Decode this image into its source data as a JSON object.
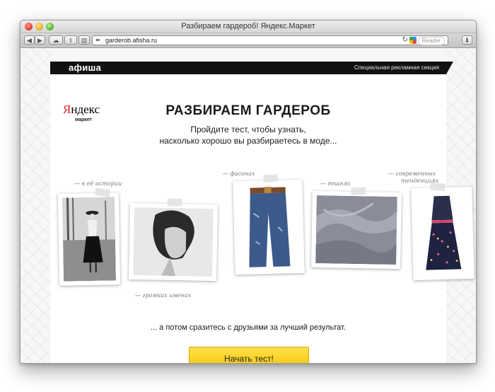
{
  "window": {
    "title": "Разбираем гардероб! Яндекс.Маркет"
  },
  "toolbar": {
    "back_icon": "chevron-left-icon",
    "forward_icon": "chevron-right-icon",
    "url": "garderob.afisha.ru",
    "reader_label": "Reader"
  },
  "afisha": {
    "logo_text": "афиша",
    "section_label": "Специальная рекламная секция"
  },
  "brand": {
    "logo_text": "Яндекс",
    "logo_first": "Я",
    "logo_rest": "ндекс",
    "sub": "маркет"
  },
  "hero": {
    "title": "РАЗБИРАЕМ ГАРДЕРОБ",
    "subtitle_line1": "Пройдите тест, чтобы узнать,",
    "subtitle_line2": "насколько хорошо вы разбираетесь в моде..."
  },
  "photos": {
    "notes": {
      "history": "— в её истории",
      "shape": "— фасонах",
      "fabric": "— тканях",
      "modern": "— современных",
      "modern2": "тенденциях",
      "names": "— громких именах"
    }
  },
  "cta": {
    "tagline": "... а потом сразитесь с друзьями за лучший результат.",
    "button_label": "Начать тест!"
  },
  "colors": {
    "accent": "#f6c300",
    "afisha_bar": "#111111",
    "yandex_red": "#e8201e"
  }
}
